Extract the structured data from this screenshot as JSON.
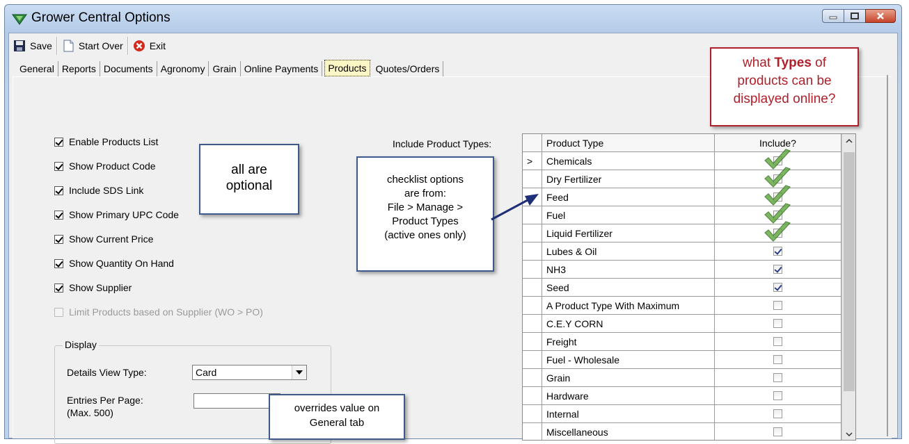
{
  "window": {
    "title": "Grower Central Options"
  },
  "toolbar": {
    "save": "Save",
    "start_over": "Start Over",
    "exit": "Exit"
  },
  "tabs": [
    "General",
    "Reports",
    "Documents",
    "Agronomy",
    "Grain",
    "Online Payments",
    "Products",
    "Quotes/Orders"
  ],
  "active_tab": "Products",
  "options": [
    {
      "label": "Enable Products List",
      "checked": true,
      "enabled": true
    },
    {
      "label": "Show Product Code",
      "checked": true,
      "enabled": true
    },
    {
      "label": "Include SDS Link",
      "checked": true,
      "enabled": true
    },
    {
      "label": "Show Primary UPC Code",
      "checked": true,
      "enabled": true
    },
    {
      "label": "Show Current Price",
      "checked": true,
      "enabled": true
    },
    {
      "label": "Show Quantity On Hand",
      "checked": true,
      "enabled": true
    },
    {
      "label": "Show Supplier",
      "checked": true,
      "enabled": true
    },
    {
      "label": "Limit Products based on Supplier (WO > PO)",
      "checked": false,
      "enabled": false
    }
  ],
  "display": {
    "legend": "Display",
    "details_view_label": "Details View Type:",
    "details_view_value": "Card",
    "entries_label": "Entries Per Page:",
    "entries_max": "(Max. 500)",
    "entries_value": ""
  },
  "include_label": "Include Product Types:",
  "grid": {
    "col_type": "Product Type",
    "col_include": "Include?",
    "current_marker": ">",
    "rows": [
      {
        "type": "Chemicals",
        "include": true,
        "highlight": true
      },
      {
        "type": "Dry Fertilizer",
        "include": true,
        "highlight": true
      },
      {
        "type": "Feed",
        "include": true,
        "highlight": true
      },
      {
        "type": "Fuel",
        "include": true,
        "highlight": true
      },
      {
        "type": "Liquid Fertilizer",
        "include": true,
        "highlight": true
      },
      {
        "type": "Lubes & Oil",
        "include": true,
        "highlight": false
      },
      {
        "type": "NH3",
        "include": true,
        "highlight": false
      },
      {
        "type": "Seed",
        "include": true,
        "highlight": false
      },
      {
        "type": "A Product Type With Maximum",
        "include": false,
        "highlight": false
      },
      {
        "type": "C.E.Y CORN",
        "include": false,
        "highlight": false
      },
      {
        "type": "Freight",
        "include": false,
        "highlight": false
      },
      {
        "type": "Fuel - Wholesale",
        "include": false,
        "highlight": false
      },
      {
        "type": "Grain",
        "include": false,
        "highlight": false
      },
      {
        "type": "Hardware",
        "include": false,
        "highlight": false
      },
      {
        "type": "Internal",
        "include": false,
        "highlight": false
      },
      {
        "type": "Miscellaneous",
        "include": false,
        "highlight": false
      }
    ]
  },
  "callouts": {
    "types_q": {
      "pre": "what ",
      "bold": "Types",
      "post": " of",
      "line2": "products can be",
      "line3": "displayed online?"
    },
    "optional": {
      "line1": "all are",
      "line2": "optional"
    },
    "checklist": {
      "line1": "checklist options",
      "line2": "are from:",
      "line3": "File > Manage >",
      "line4": "Product Types",
      "line5": "(active ones only)"
    },
    "overrides": {
      "line1": "overrides value on",
      "line2": "General tab"
    }
  },
  "colors": {
    "callout_red": "#b0202a",
    "callout_blue": "#3e5a8c",
    "active_tab_bg": "#fdf7c6",
    "check_green": "#5da63a"
  }
}
